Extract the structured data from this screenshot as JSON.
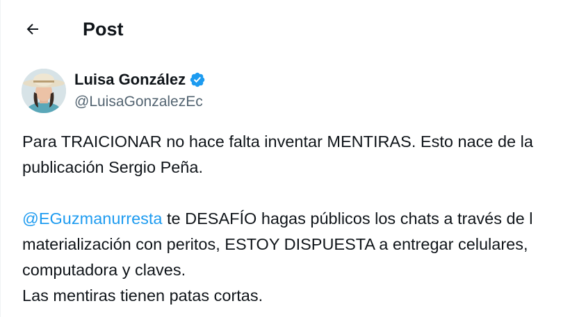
{
  "header": {
    "title": "Post"
  },
  "author": {
    "name": "Luisa González",
    "handle": "@LuisaGonzalezEc"
  },
  "tweet": {
    "line1": "Para TRAICIONAR no hace falta inventar MENTIRAS. Esto nace de la",
    "line2": "publicación Sergio Peña.",
    "mention": "@EGuzmanurresta",
    "line3_rest": " te DESAFÍO hagas públicos los chats a través de l",
    "line4": "materialización con peritos, ESTOY DISPUESTA a entregar celulares,",
    "line5": "computadora y claves.",
    "line6": "Las mentiras tienen patas cortas."
  },
  "colors": {
    "link": "#1d9bf0",
    "verified": "#1d9bf0",
    "secondary_text": "#536471"
  },
  "icons": {
    "back": "arrow-left-icon",
    "verified": "verified-badge-icon"
  }
}
